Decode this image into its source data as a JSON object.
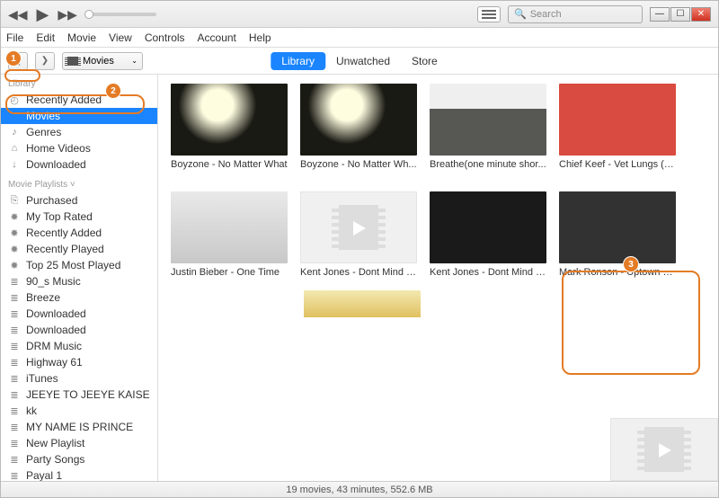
{
  "search": {
    "placeholder": "Search"
  },
  "menubar": [
    "File",
    "Edit",
    "Movie",
    "View",
    "Controls",
    "Account",
    "Help"
  ],
  "nav": {
    "media_select": "Movies",
    "tabs": [
      {
        "label": "Library",
        "active": true
      },
      {
        "label": "Unwatched",
        "active": false
      },
      {
        "label": "Store",
        "active": false
      }
    ]
  },
  "sidebar": {
    "library_label": "Library",
    "library_items": [
      {
        "icon": "◴",
        "label": "Recently Added",
        "name": "sidebar-item-recently-added"
      },
      {
        "icon": "film",
        "label": "Movies",
        "name": "sidebar-item-movies",
        "selected": true
      },
      {
        "icon": "♪",
        "label": "Genres",
        "name": "sidebar-item-genres"
      },
      {
        "icon": "⌂",
        "label": "Home Videos",
        "name": "sidebar-item-home-videos"
      },
      {
        "icon": "↓",
        "label": "Downloaded",
        "name": "sidebar-item-downloaded"
      }
    ],
    "playlists_label": "Movie Playlists ˅",
    "playlist_items": [
      {
        "icon": "⎘",
        "label": "Purchased"
      },
      {
        "icon": "✸",
        "label": "My Top Rated"
      },
      {
        "icon": "✸",
        "label": "Recently Added"
      },
      {
        "icon": "✸",
        "label": "Recently Played"
      },
      {
        "icon": "✸",
        "label": "Top 25 Most Played"
      },
      {
        "icon": "≣",
        "label": "90_s Music"
      },
      {
        "icon": "≣",
        "label": "Breeze"
      },
      {
        "icon": "≣",
        "label": "Downloaded"
      },
      {
        "icon": "≣",
        "label": "Downloaded"
      },
      {
        "icon": "≣",
        "label": "DRM Music"
      },
      {
        "icon": "≣",
        "label": "Highway 61"
      },
      {
        "icon": "≣",
        "label": "iTunes"
      },
      {
        "icon": "≣",
        "label": "JEEYE TO JEEYE KAISE"
      },
      {
        "icon": "≣",
        "label": "kk"
      },
      {
        "icon": "≣",
        "label": "MY NAME IS PRINCE"
      },
      {
        "icon": "≣",
        "label": "New Playlist"
      },
      {
        "icon": "≣",
        "label": "Party Songs"
      },
      {
        "icon": "≣",
        "label": "Payal 1"
      }
    ]
  },
  "movies": [
    {
      "title": "Boyzone - No Matter What",
      "thumb": "boyzone"
    },
    {
      "title": "Boyzone - No Matter Wh...",
      "thumb": "boyzone"
    },
    {
      "title": "Breathe(one minute shor...",
      "thumb": "breathe"
    },
    {
      "title": "Chief Keef - Vet Lungs (S...",
      "thumb": "chief"
    },
    {
      "title": "Justin Bieber - One Time",
      "thumb": "jb"
    },
    {
      "title": "Kent Jones - Dont Mind (...",
      "thumb": "film-ph"
    },
    {
      "title": "Kent Jones - Dont Mind (...",
      "thumb": "kent"
    },
    {
      "title": "Mark Ronson - Uptown F...",
      "thumb": "mark"
    }
  ],
  "statusbar": "19 movies, 43 minutes, 552.6 MB",
  "annotations": {
    "a1": "1",
    "a2": "2",
    "a3": "3"
  }
}
